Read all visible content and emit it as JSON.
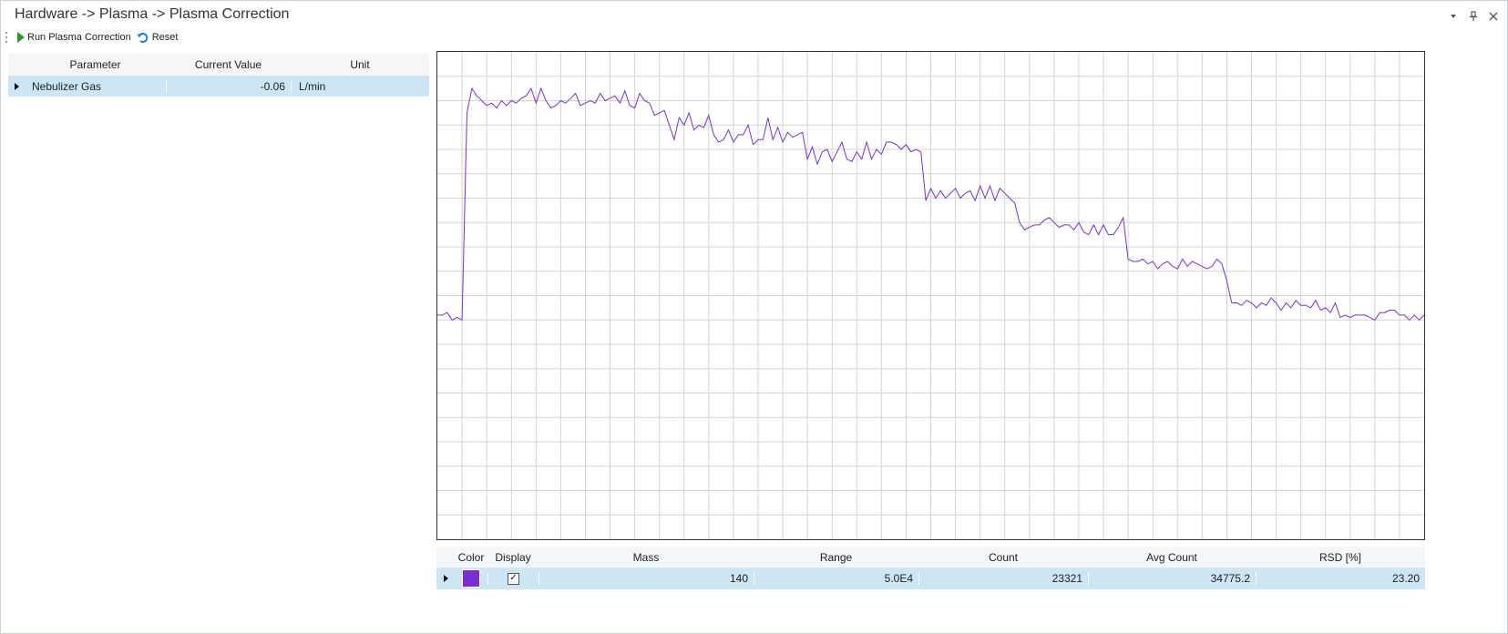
{
  "window": {
    "title": "Hardware -> Plasma -> Plasma Correction",
    "controls": [
      "dropdown-icon",
      "pin-icon",
      "close-icon"
    ]
  },
  "toolbar": {
    "run_label": "Run Plasma Correction",
    "reset_label": "Reset"
  },
  "param_table": {
    "headers": {
      "parameter": "Parameter",
      "current_value": "Current Value",
      "unit": "Unit"
    },
    "rows": [
      {
        "parameter": "Nebulizer Gas",
        "current_value": "-0.06",
        "unit": "L/min"
      }
    ]
  },
  "legend_table": {
    "headers": {
      "color": "Color",
      "display": "Display",
      "mass": "Mass",
      "range": "Range",
      "count": "Count",
      "avg_count": "Avg Count",
      "rsd": "RSD [%]"
    },
    "rows": [
      {
        "color": "#7b2fd0",
        "display_checked": "✓",
        "mass": "140",
        "range": "5.0E4",
        "count": "23321",
        "avg_count": "34775.2",
        "rsd": "23.20"
      }
    ]
  },
  "chart_data": {
    "type": "line",
    "grid": true,
    "series_color": "#7b2fd0",
    "xlim": [
      0,
      200
    ],
    "ylim": [
      0,
      20
    ],
    "x_step": 1,
    "values": [
      9.2,
      9.2,
      9.3,
      9.0,
      9.1,
      9.0,
      17.5,
      18.5,
      18.2,
      18.0,
      17.8,
      17.9,
      17.7,
      18.0,
      17.8,
      18.0,
      17.9,
      18.1,
      18.2,
      18.5,
      17.9,
      18.5,
      18.0,
      17.7,
      17.8,
      18.0,
      17.9,
      18.1,
      18.3,
      17.8,
      17.9,
      18.0,
      17.9,
      18.3,
      18.0,
      18.1,
      18.2,
      17.9,
      18.4,
      17.8,
      17.7,
      18.3,
      18.0,
      17.9,
      17.4,
      17.5,
      17.6,
      17.0,
      16.4,
      17.3,
      17.0,
      17.5,
      16.8,
      17.0,
      16.9,
      17.4,
      16.6,
      16.3,
      16.4,
      16.8,
      16.3,
      16.6,
      16.6,
      17.0,
      16.2,
      16.4,
      16.4,
      17.3,
      16.4,
      16.9,
      16.3,
      16.7,
      16.5,
      16.6,
      16.7,
      15.6,
      16.1,
      15.4,
      15.9,
      16.0,
      15.5,
      15.9,
      16.3,
      15.6,
      15.5,
      15.9,
      15.6,
      16.3,
      15.6,
      16.0,
      15.8,
      16.3,
      16.3,
      16.2,
      16.0,
      16.2,
      15.9,
      16.0,
      15.9,
      13.9,
      14.4,
      14.0,
      14.3,
      14.0,
      14.2,
      14.4,
      14.0,
      14.2,
      14.3,
      13.9,
      14.5,
      14.0,
      14.5,
      13.9,
      14.4,
      14.2,
      14.0,
      13.8,
      13.0,
      12.7,
      12.8,
      12.9,
      12.9,
      13.1,
      13.2,
      13.0,
      12.8,
      12.9,
      12.9,
      12.7,
      13.0,
      12.6,
      12.5,
      12.9,
      12.5,
      12.9,
      12.5,
      12.5,
      12.8,
      13.2,
      11.5,
      11.4,
      11.4,
      11.5,
      11.3,
      11.4,
      11.1,
      11.3,
      11.4,
      11.2,
      11.1,
      11.5,
      11.2,
      11.4,
      11.3,
      11.2,
      11.1,
      11.2,
      11.5,
      11.3,
      10.6,
      9.7,
      9.7,
      9.6,
      9.8,
      9.7,
      9.5,
      9.7,
      9.6,
      9.9,
      9.7,
      9.4,
      9.7,
      9.5,
      9.8,
      9.6,
      9.6,
      9.5,
      9.8,
      9.4,
      9.5,
      9.3,
      9.7,
      9.1,
      9.2,
      9.1,
      9.2,
      9.2,
      9.2,
      9.1,
      9.0,
      9.3,
      9.3,
      9.4,
      9.4,
      9.2,
      9.2,
      9.0,
      9.2,
      9.0,
      9.2,
      9.5,
      9.3,
      9.3
    ]
  }
}
